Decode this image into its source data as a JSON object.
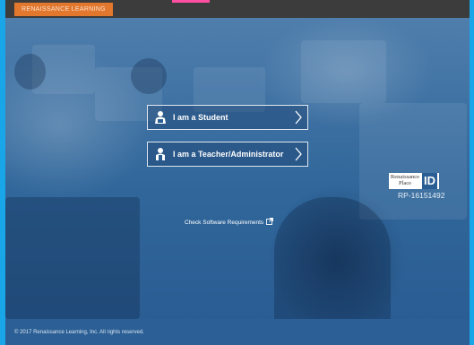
{
  "brand": {
    "logo_text": "RENAISSANCE LEARNING"
  },
  "roles": [
    {
      "label": "I am a Student",
      "icon": "student-icon"
    },
    {
      "label": "I am a Teacher/Administrator",
      "icon": "teacher-icon"
    }
  ],
  "links": {
    "software_requirements": "Check Software Requirements"
  },
  "rp_badge": {
    "logo_line1": "Renaissance",
    "logo_line2": "Place",
    "id_text": "ID",
    "site_id": "RP-16151492"
  },
  "footer": {
    "copyright": "© 2017 Renaissance Learning, Inc. All rights reserved."
  },
  "colors": {
    "frame": "#19a6e8",
    "topbar": "#3c3c3c",
    "logo_bg": "#e2772e",
    "hero": "#2a5d93"
  }
}
